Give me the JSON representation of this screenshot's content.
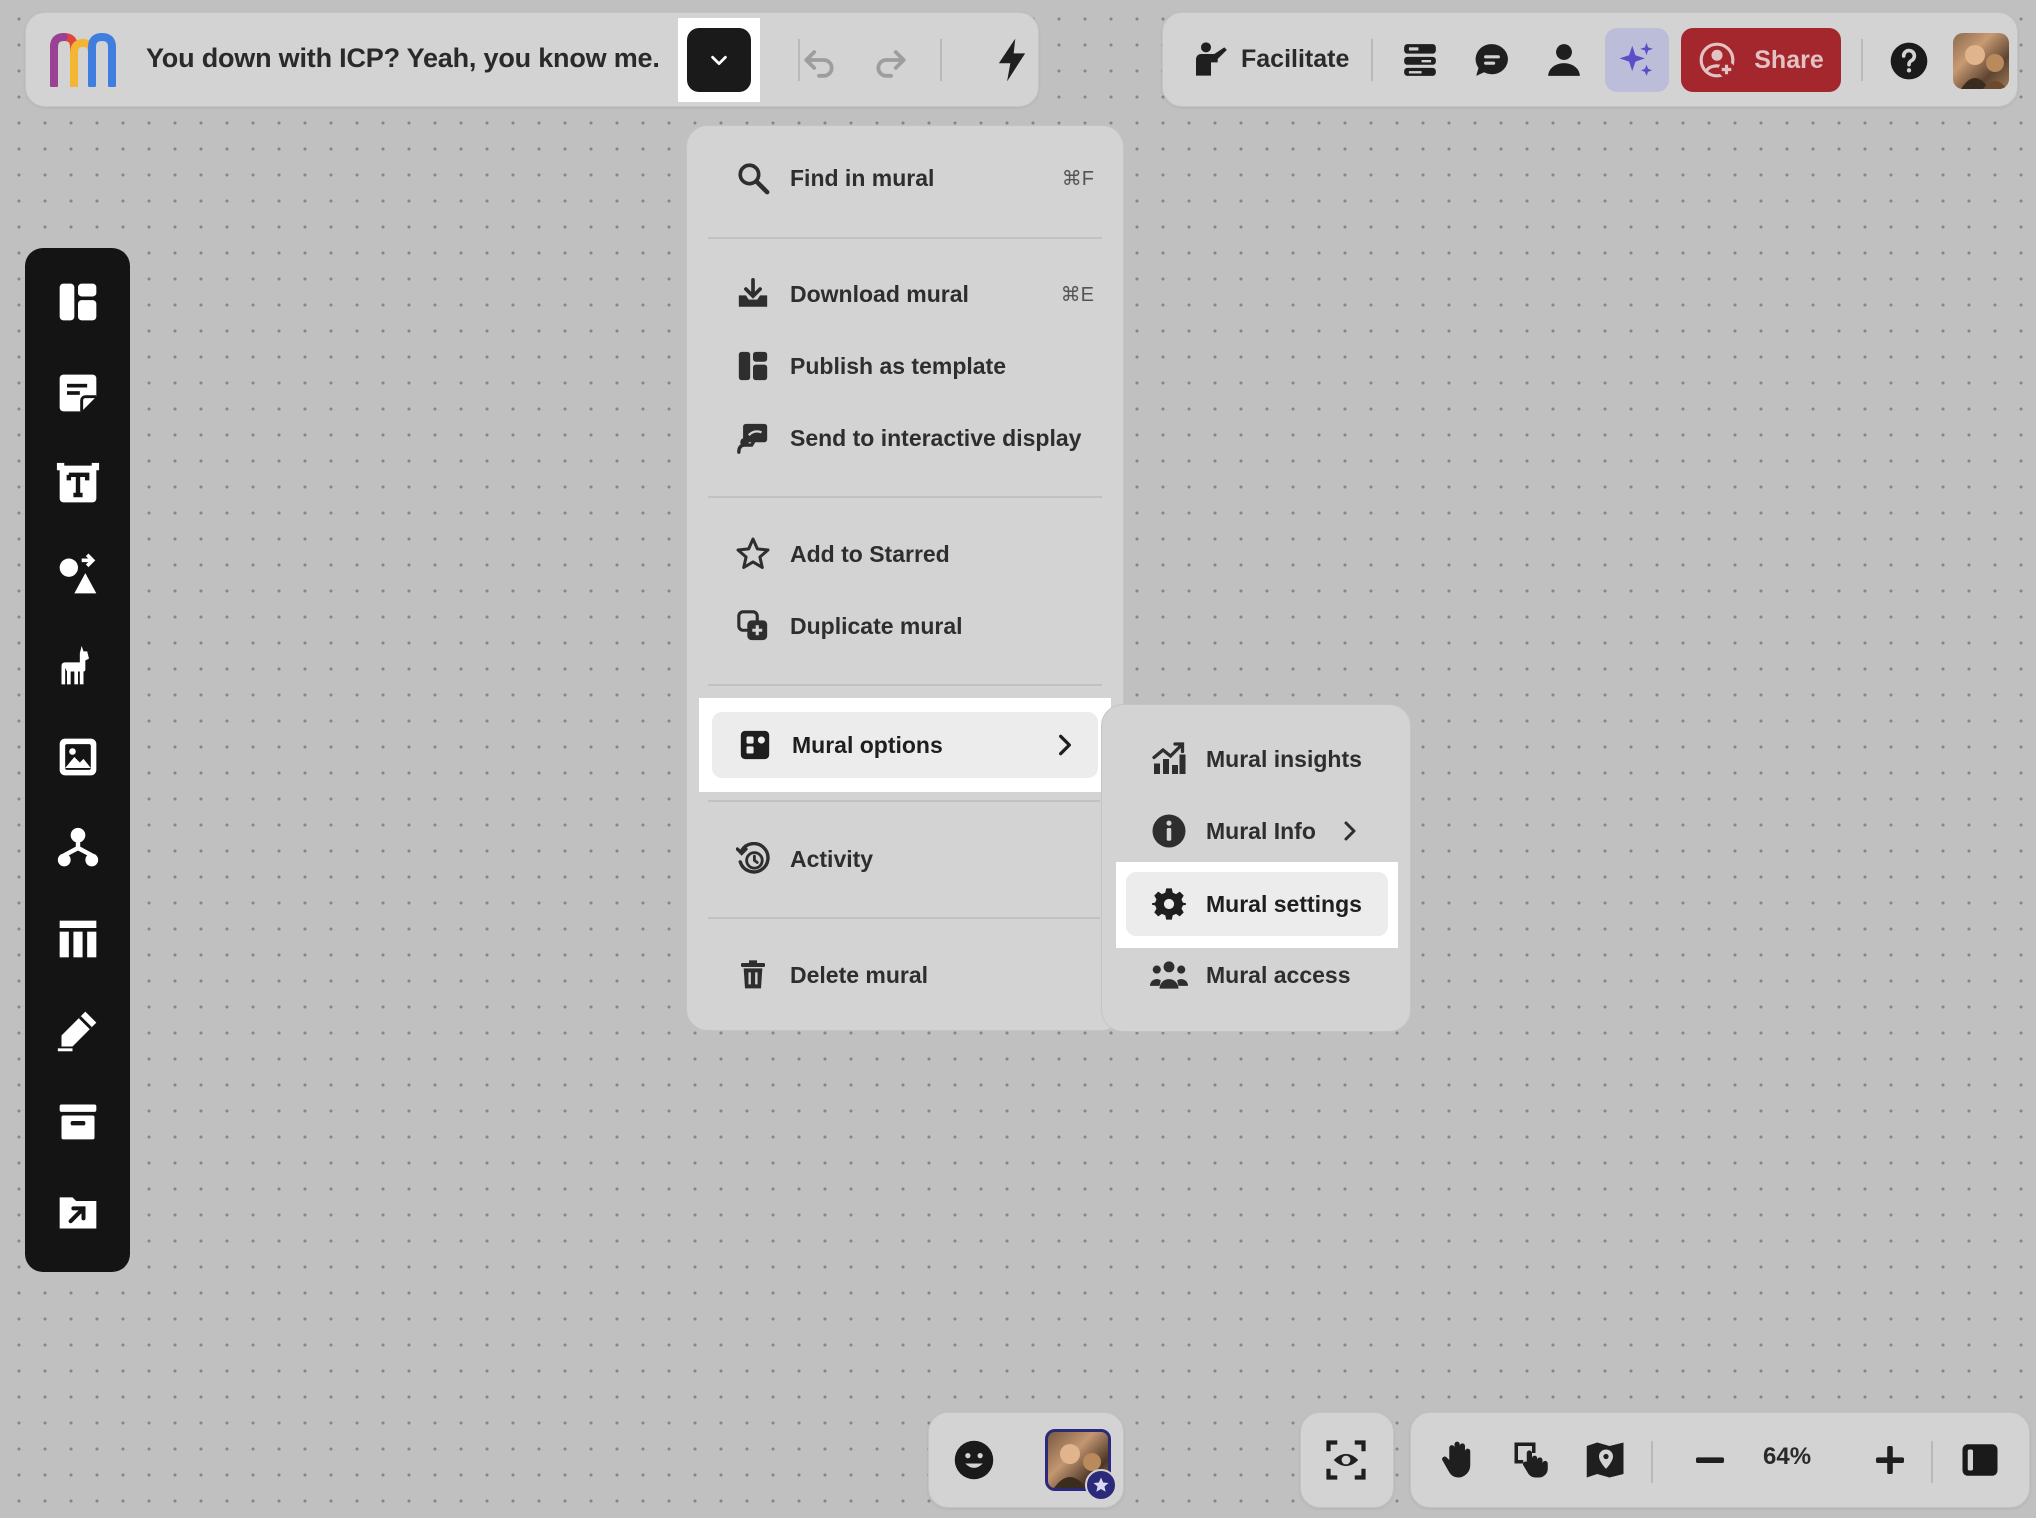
{
  "header": {
    "title": "You down with ICP? Yeah, you know me."
  },
  "topbar_right": {
    "facilitate_label": "Facilitate",
    "share_label": "Share"
  },
  "main_menu": {
    "items": [
      {
        "label": "Find in mural",
        "shortcut": "⌘F",
        "icon": "search-icon"
      },
      {
        "label": "Download mural",
        "shortcut": "⌘E",
        "icon": "download-icon"
      },
      {
        "label": "Publish as template",
        "shortcut": "",
        "icon": "template-icon"
      },
      {
        "label": "Send to interactive display",
        "shortcut": "",
        "icon": "display-icon"
      },
      {
        "label": "Add to Starred",
        "shortcut": "",
        "icon": "star-icon"
      },
      {
        "label": "Duplicate mural",
        "shortcut": "",
        "icon": "duplicate-icon"
      },
      {
        "label": "Mural options",
        "shortcut": "",
        "icon": "mural-options-icon"
      },
      {
        "label": "Activity",
        "shortcut": "",
        "icon": "history-icon"
      },
      {
        "label": "Delete mural",
        "shortcut": "",
        "icon": "trash-icon"
      }
    ]
  },
  "sub_menu": {
    "items": [
      {
        "label": "Mural insights",
        "icon": "chart-icon"
      },
      {
        "label": "Mural Info",
        "icon": "info-icon"
      },
      {
        "label": "Mural settings",
        "icon": "gear-icon"
      },
      {
        "label": "Mural access",
        "icon": "people-icon"
      }
    ]
  },
  "bottom": {
    "zoom": "64%"
  },
  "colors": {
    "share_bg": "#a3272c",
    "ai_bg": "#bcbdd8",
    "toolbar_bg": "#141414",
    "collab_ring": "#2b2a7a"
  }
}
